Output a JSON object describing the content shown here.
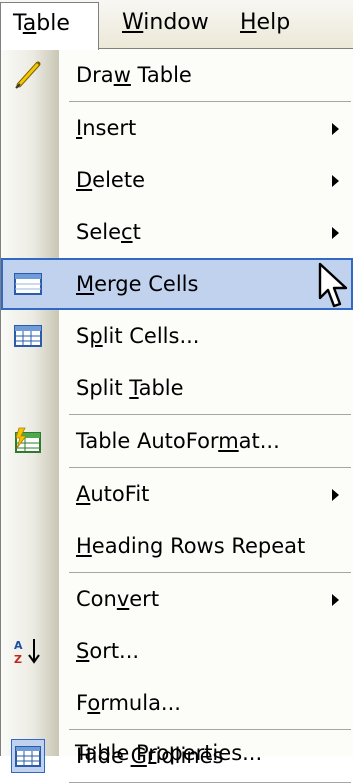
{
  "menubar": {
    "table": "Table",
    "window": "Window",
    "help": "Help"
  },
  "menu": {
    "draw_table": "Draw Table",
    "insert": "Insert",
    "delete": "Delete",
    "select": "Select",
    "merge_cells": "Merge Cells",
    "split_cells": "Split Cells...",
    "split_table": "Split Table",
    "table_autoformat": "Table AutoFormat...",
    "autofit": "AutoFit",
    "heading_rows_repeat": "Heading Rows Repeat",
    "convert": "Convert",
    "sort": "Sort...",
    "formula": "Formula...",
    "hide_gridlines": "Hide Gridlines",
    "table_properties": "Table Properties..."
  },
  "hovered_item": "Merge Cells",
  "icons": {
    "draw_table": "pencil-icon",
    "merge_cells": "merge-cells-icon",
    "split_cells": "split-cells-icon",
    "table_autoformat": "table-autoformat-icon",
    "sort": "sort-ascending-icon",
    "hide_gridlines": "gridlines-icon",
    "cursor": "mouse-pointer-icon"
  },
  "colors": {
    "highlight_fill": "#c1d2ee",
    "highlight_border": "#316ac5",
    "menubar_bg": "#ece9d8"
  }
}
